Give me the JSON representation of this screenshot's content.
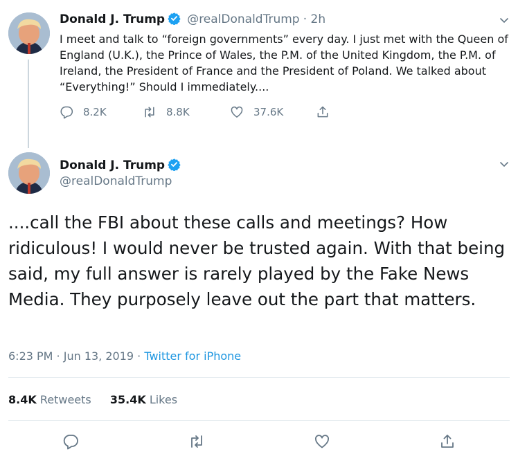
{
  "tweet1": {
    "name": "Donald J. Trump",
    "handle": "@realDonaldTrump",
    "time": "· 2h",
    "text": "I meet and talk to “foreign governments” every day. I just met with the Queen of England (U.K.), the Prince of Wales, the P.M. of the United Kingdom, the P.M. of Ireland, the President of France and the President of Poland. We talked about “Everything!” Should I immediately....",
    "replies": "8.2K",
    "retweets": "8.8K",
    "likes": "37.6K"
  },
  "tweet2": {
    "name": "Donald J. Trump",
    "handle": "@realDonaldTrump",
    "text": "....call the FBI about these calls and meetings? How ridiculous! I would never be trusted again. With that being said, my full answer is rarely played by the Fake News Media. They purposely leave out the part that matters.",
    "time": "6:23 PM · Jun 13, 2019 ·",
    "source": "Twitter for iPhone",
    "retweets_count": "8.4K",
    "retweets_label": "Retweets",
    "likes_count": "35.4K",
    "likes_label": "Likes"
  },
  "icons": {
    "reply": "reply-icon",
    "retweet": "retweet-icon",
    "like": "heart-icon",
    "share": "share-icon",
    "verified": "verified-badge-icon",
    "more": "chevron-down-icon"
  },
  "colors": {
    "text": "#14171a",
    "secondary": "#657786",
    "link": "#1b95e0",
    "verified": "#1da1f2",
    "divider": "#e6ecf0"
  }
}
